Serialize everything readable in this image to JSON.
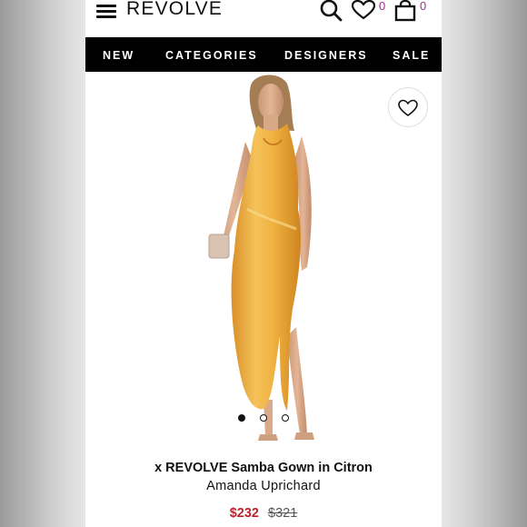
{
  "header": {
    "logo": "REVOLVE",
    "wishlist_count": "0",
    "cart_count": "0"
  },
  "nav": {
    "items": [
      "NEW",
      "CATEGORIES",
      "DESIGNERS",
      "SALE"
    ]
  },
  "gallery": {
    "total_images": 3,
    "active_index": 0
  },
  "product": {
    "title": "x REVOLVE Samba Gown in Citron",
    "designer": "Amanda Uprichard",
    "sale_price": "$232",
    "original_price": "$321"
  },
  "colors": {
    "nav_background": "#000000",
    "sale_price": "#b8232b",
    "badge_count": "#9b2f8f",
    "dress": "#f0b240"
  },
  "icons": [
    "menu-icon",
    "search-icon",
    "heart-icon",
    "shopping-bag-icon"
  ]
}
